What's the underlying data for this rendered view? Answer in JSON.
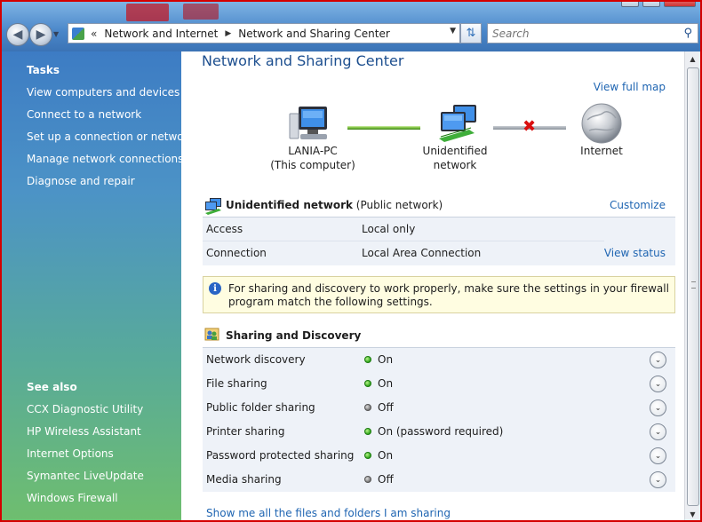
{
  "address": {
    "overflow_chevron": "«",
    "segments": [
      "Network and Internet",
      "Network and Sharing Center"
    ],
    "search_placeholder": "Search"
  },
  "sidebar": {
    "tasks_title": "Tasks",
    "tasks": [
      "View computers and devices",
      "Connect to a network",
      "Set up a connection or network",
      "Manage network connections",
      "Diagnose and repair"
    ],
    "see_also_title": "See also",
    "see_also": [
      "CCX Diagnostic Utility",
      "HP Wireless Assistant",
      "Internet Options",
      "Symantec LiveUpdate",
      "Windows Firewall"
    ]
  },
  "main": {
    "title": "Network and Sharing Center",
    "view_full_map": "View full map",
    "map": {
      "computer_name": "LANIA-PC",
      "computer_sub": "(This computer)",
      "network_name": "Unidentified network",
      "internet": "Internet"
    },
    "network": {
      "name": "Unidentified network",
      "type": "(Public network)",
      "customize": "Customize",
      "rows": [
        {
          "label": "Access",
          "value": "Local only"
        },
        {
          "label": "Connection",
          "value": "Local Area Connection"
        }
      ],
      "view_status": "View status"
    },
    "info_text": "For sharing and discovery to work properly, make sure the settings in your firewall program match the following settings.",
    "sharing": {
      "title": "Sharing and Discovery",
      "rows": [
        {
          "label": "Network discovery",
          "status": "On",
          "state": "on"
        },
        {
          "label": "File sharing",
          "status": "On",
          "state": "on"
        },
        {
          "label": "Public folder sharing",
          "status": "Off",
          "state": "off"
        },
        {
          "label": "Printer sharing",
          "status": "On (password required)",
          "state": "on"
        },
        {
          "label": "Password protected sharing",
          "status": "On",
          "state": "on"
        },
        {
          "label": "Media sharing",
          "status": "Off",
          "state": "off"
        }
      ]
    },
    "bottom_link": "Show me all the files and folders I am sharing"
  }
}
